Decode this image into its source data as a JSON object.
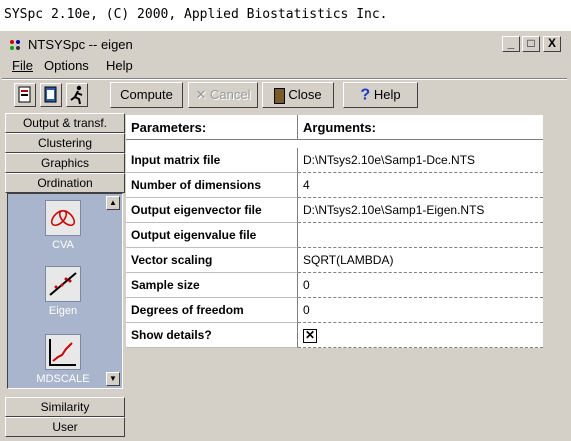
{
  "console_line": "SYSpc 2.10e, (C) 2000, Applied Biostatistics Inc.",
  "window": {
    "title": "NTSYSpc  -- eigen",
    "min": "_",
    "max": "□",
    "close": "X"
  },
  "menu": [
    "File",
    "Options",
    "Help"
  ],
  "toolbar": {
    "compute": "Compute",
    "cancel": "Cancel",
    "close": "Close",
    "help": "Help"
  },
  "categories_top": [
    "Output & transf.",
    "Clustering",
    "Graphics",
    "Ordination"
  ],
  "categories_bottom": [
    "Similarity",
    "User"
  ],
  "programs": [
    "CVA",
    "Eigen",
    "MDSCALE"
  ],
  "table": {
    "header": {
      "param": "Parameters:",
      "arg": "Arguments:"
    },
    "rows": [
      {
        "param": "Input matrix file",
        "arg": "D:\\NTsys2.10e\\Samp1-Dce.NTS"
      },
      {
        "param": "Number of dimensions",
        "arg": "4"
      },
      {
        "param": "Output eigenvector file",
        "arg": "D:\\NTsys2.10e\\Samp1-Eigen.NTS"
      },
      {
        "param": "Output eigenvalue file",
        "arg": ""
      },
      {
        "param": "Vector scaling",
        "arg": "SQRT(LAMBDA)"
      },
      {
        "param": "Sample size",
        "arg": "0"
      },
      {
        "param": "Degrees of freedom",
        "arg": "0"
      },
      {
        "param": "Show details?",
        "arg": ""
      }
    ],
    "show_details_checked": true
  }
}
